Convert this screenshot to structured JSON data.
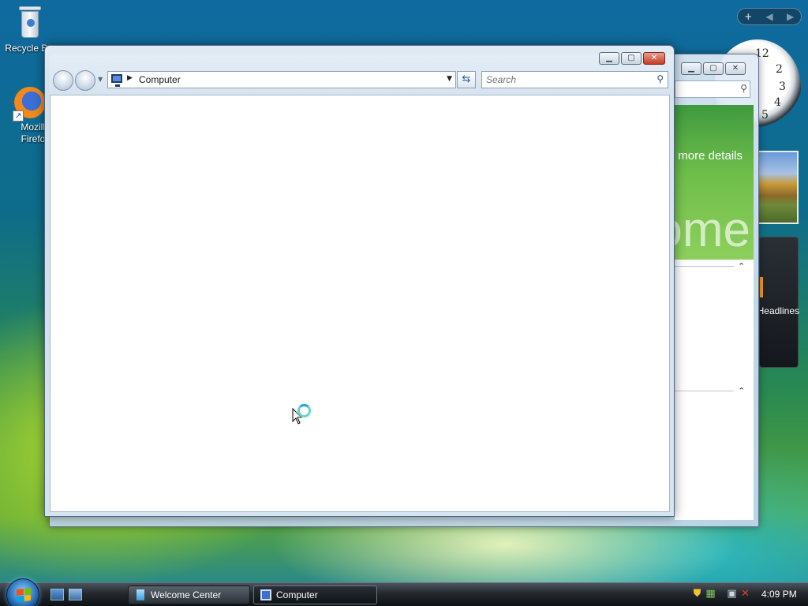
{
  "desktop": {
    "icons": [
      {
        "label": "Recycle Bin",
        "icon": "recycle-bin-icon"
      },
      {
        "label": "Mozilla Firefox",
        "icon": "firefox-icon"
      }
    ]
  },
  "gadgets": {
    "controls": [
      "+",
      "◀",
      "▶"
    ],
    "clock_numbers": [
      "12",
      "2",
      "3",
      "4",
      "5"
    ],
    "feed_text": "Headlines"
  },
  "welcome_window": {
    "title": "Welcome Center",
    "banner_details": "Show more details",
    "banner_big": "Welcome"
  },
  "computer_window": {
    "title": "Computer",
    "address": {
      "crumb": "Computer"
    },
    "search": {
      "placeholder": "Search"
    }
  },
  "taskbar": {
    "tasks": [
      {
        "label": "Welcome Center",
        "active": false
      },
      {
        "label": "Computer",
        "active": true
      }
    ],
    "clock": "4:09 PM"
  },
  "colors": {
    "accent": "#2a6fb8",
    "close_button": "#c43b22",
    "banner_green": "#6fbe4a"
  }
}
